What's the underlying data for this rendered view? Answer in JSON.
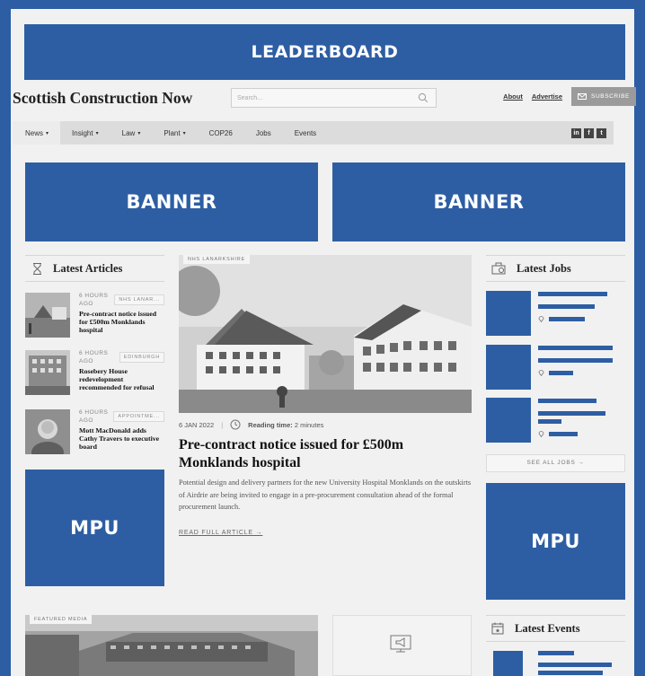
{
  "ads": {
    "leaderboard": "LEADERBOARD",
    "banner_left": "BANNER",
    "banner_right": "BANNER",
    "mpu_left": "MPU",
    "mpu_right": "MPU"
  },
  "header": {
    "logo": "Scottish Construction Now",
    "search_placeholder": "Search...",
    "about": "About",
    "advertise": "Advertise",
    "subscribe": "SUBSCRIBE"
  },
  "nav": {
    "items": [
      "News",
      "Insight",
      "Law",
      "Plant",
      "COP26",
      "Jobs",
      "Events"
    ]
  },
  "latest_articles": {
    "heading": "Latest Articles",
    "items": [
      {
        "time": "6 HOURS AGO",
        "tag": "NHS LANAR...",
        "title": "Pre-contract notice issued for £500m Monklands hospital"
      },
      {
        "time": "6 HOURS AGO",
        "tag": "EDINBURGH",
        "title": "Rosebery House redevelopment recommended for refusal"
      },
      {
        "time": "6 HOURS AGO",
        "tag": "APPOINTME...",
        "title": "Mott MacDonald adds Cathy Travers to executive board"
      }
    ]
  },
  "feature": {
    "tag": "NHS LANARKSHIRE",
    "date": "6 JAN 2022",
    "reading_label": "Reading time:",
    "reading_value": "2 minutes",
    "title": "Pre-contract notice issued for £500m Monklands hospital",
    "summary": "Potential design and delivery partners for the new University Hospital Monklands on the outskirts of Airdrie are being invited to engage in a pre-procurement consultation ahead of the formal procurement launch.",
    "read_more": "READ FULL ARTICLE →"
  },
  "latest_jobs": {
    "heading": "Latest Jobs",
    "see_all": "SEE ALL JOBS →"
  },
  "featured_media": {
    "tag": "FEATURED MEDIA"
  },
  "latest_events": {
    "heading": "Latest Events"
  }
}
